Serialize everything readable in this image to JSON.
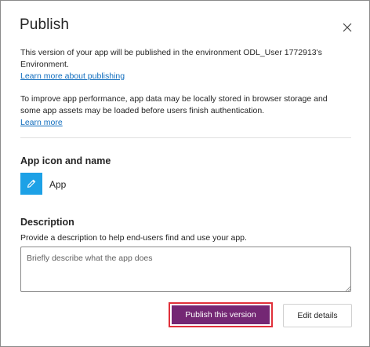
{
  "dialog": {
    "title": "Publish",
    "close_icon": "close-icon"
  },
  "info": {
    "line1": "This version of your app will be published in the environment ODL_User 1772913's Environment.",
    "learn_publishing": "Learn more about publishing",
    "line2": "To improve app performance, app data may be locally stored in browser storage and some app assets may be loaded before users finish authentication.",
    "learn_more": "Learn more"
  },
  "app_section": {
    "heading": "App icon and name",
    "icon": "pencil-icon",
    "icon_bg": "#1da1e6",
    "app_name": "App"
  },
  "description": {
    "heading": "Description",
    "hint": "Provide a description to help end-users find and use your app.",
    "placeholder": "Briefly describe what the app does",
    "value": ""
  },
  "buttons": {
    "publish": "Publish this version",
    "edit": "Edit details"
  },
  "colors": {
    "primary": "#742774",
    "highlight": "#e0303a",
    "link": "#0f6cbd"
  }
}
